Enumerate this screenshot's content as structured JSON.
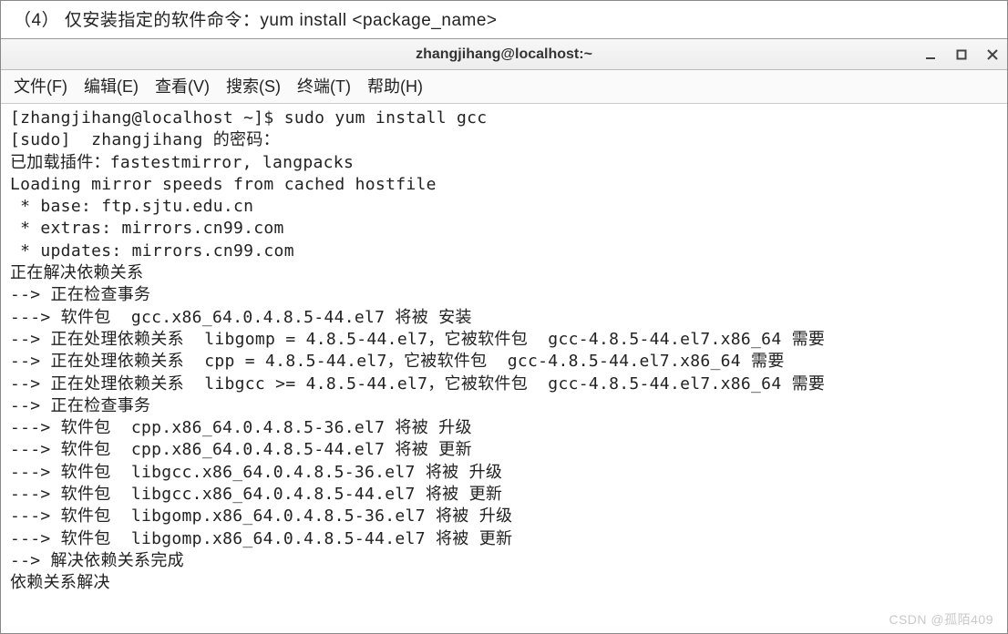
{
  "caption": "（4） 仅安装指定的软件命令：yum install <package_name>",
  "window": {
    "title": "zhangjihang@localhost:~"
  },
  "menubar": {
    "items": [
      {
        "label": "文件(F)"
      },
      {
        "label": "编辑(E)"
      },
      {
        "label": "查看(V)"
      },
      {
        "label": "搜索(S)"
      },
      {
        "label": "终端(T)"
      },
      {
        "label": "帮助(H)"
      }
    ]
  },
  "terminal": {
    "lines": [
      "[zhangjihang@localhost ~]$ sudo yum install gcc",
      "[sudo]  zhangjihang 的密码：",
      "已加载插件：fastestmirror, langpacks",
      "Loading mirror speeds from cached hostfile",
      " * base: ftp.sjtu.edu.cn",
      " * extras: mirrors.cn99.com",
      " * updates: mirrors.cn99.com",
      "正在解决依赖关系",
      "--> 正在检查事务",
      "---> 软件包  gcc.x86_64.0.4.8.5-44.el7 将被 安装",
      "--> 正在处理依赖关系  libgomp = 4.8.5-44.el7，它被软件包  gcc-4.8.5-44.el7.x86_64 需要",
      "--> 正在处理依赖关系  cpp = 4.8.5-44.el7，它被软件包  gcc-4.8.5-44.el7.x86_64 需要",
      "--> 正在处理依赖关系  libgcc >= 4.8.5-44.el7，它被软件包  gcc-4.8.5-44.el7.x86_64 需要",
      "--> 正在检查事务",
      "---> 软件包  cpp.x86_64.0.4.8.5-36.el7 将被 升级",
      "---> 软件包  cpp.x86_64.0.4.8.5-44.el7 将被 更新",
      "---> 软件包  libgcc.x86_64.0.4.8.5-36.el7 将被 升级",
      "---> 软件包  libgcc.x86_64.0.4.8.5-44.el7 将被 更新",
      "---> 软件包  libgomp.x86_64.0.4.8.5-36.el7 将被 升级",
      "---> 软件包  libgomp.x86_64.0.4.8.5-44.el7 将被 更新",
      "--> 解决依赖关系完成",
      "",
      "依赖关系解决"
    ]
  },
  "watermark": "CSDN @孤陌409"
}
